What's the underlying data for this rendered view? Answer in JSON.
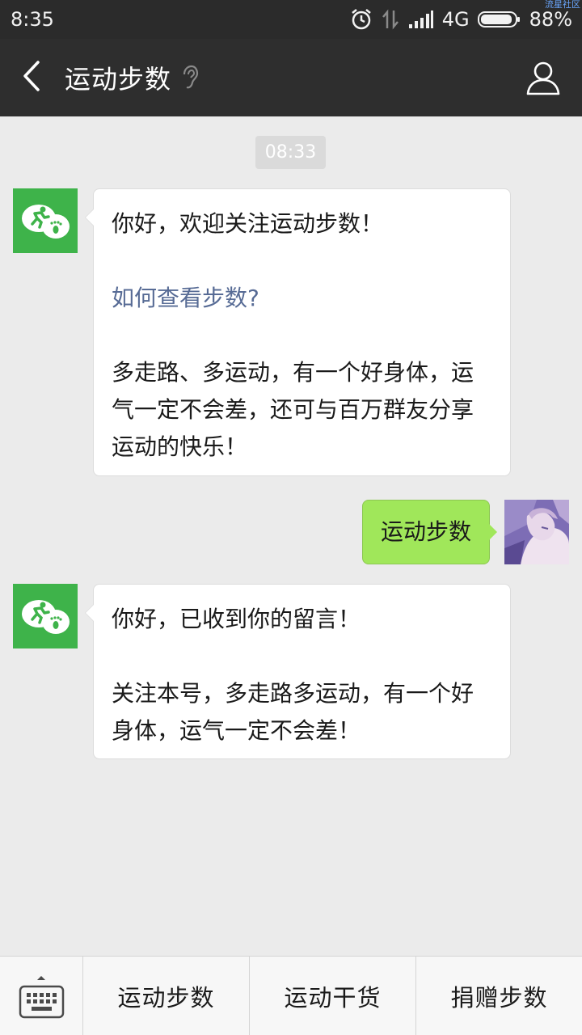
{
  "status_bar": {
    "time": "8:35",
    "network": "4G",
    "battery": "88%",
    "watermark": "流星社区"
  },
  "header": {
    "title": "运动步数"
  },
  "chat": {
    "timestamp": "08:33",
    "messages": [
      {
        "from": "bot",
        "line1": "你好，欢迎关注运动步数！",
        "link": "如何查看步数?",
        "line2": "多走路、多运动，有一个好身体，运气一定不会差，还可与百万群友分享运动的快乐！"
      },
      {
        "from": "user",
        "text": "运动步数"
      },
      {
        "from": "bot",
        "line1": "你好，已收到你的留言！",
        "line2": "关注本号，多走路多运动，有一个好身体，运气一定不会差！"
      }
    ]
  },
  "menu": {
    "items": [
      "运动步数",
      "运动干货",
      "捐赠步数"
    ]
  },
  "colors": {
    "bot_avatar": "#3eb34a",
    "outgoing_bubble": "#a0e75a",
    "link": "#576b95",
    "title_bar": "#2e2e2e"
  }
}
